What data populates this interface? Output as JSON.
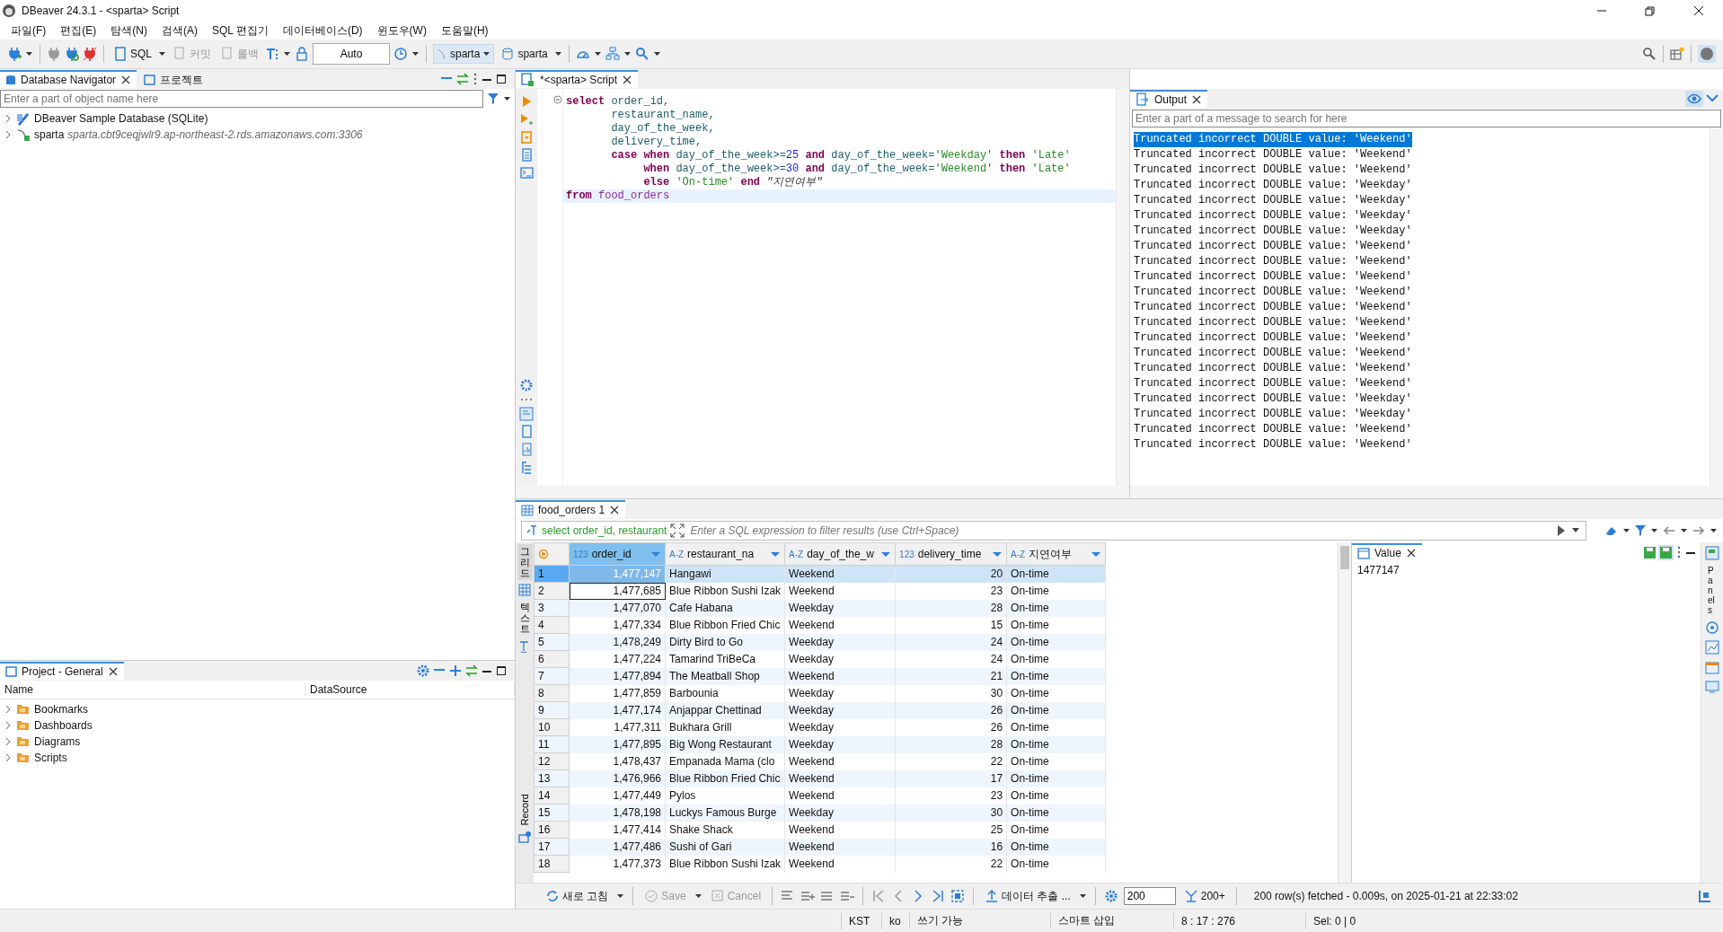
{
  "window": {
    "title": "DBeaver 24.3.1 - <sparta> Script"
  },
  "menu": [
    "파일(F)",
    "편집(E)",
    "탐색(N)",
    "검색(A)",
    "SQL 편집기",
    "데이터베이스(D)",
    "윈도우(W)",
    "도움말(H)"
  ],
  "toolbar": {
    "sql": {
      "label": "SQL"
    },
    "commit": {
      "label": "커밋",
      "disabled": true
    },
    "rollback": {
      "label": "롤백",
      "disabled": true
    },
    "transaction_mode": {
      "value": "Auto"
    },
    "datasource": {
      "label": "sparta"
    },
    "schema": {
      "label": "sparta"
    }
  },
  "navigator": {
    "tabs": [
      {
        "label": "Database Navigator",
        "selected": true
      },
      {
        "label": "프로젝트",
        "selected": false
      }
    ],
    "search": {
      "placeholder": "Enter a part of object name here"
    },
    "tree": [
      {
        "name": "DBeaver Sample Database (SQLite)",
        "kind": "sqlite"
      },
      {
        "name": "sparta",
        "detail": "sparta.cbt9ceqjwlr9.ap-northeast-2.rds.amazonaws.com:3306",
        "kind": "mysql"
      }
    ]
  },
  "project": {
    "title": "Project - General",
    "columns": [
      "Name",
      "DataSource"
    ],
    "items": [
      "Bookmarks",
      "Dashboards",
      "Diagrams",
      "Scripts"
    ]
  },
  "editor": {
    "tab": "*<sparta> Script",
    "lines": [
      [
        {
          "t": "select",
          "kind": "keyword"
        },
        {
          "t": " order_id,",
          "kind": "identifier"
        }
      ],
      [
        {
          "t": "       restaurant_name,",
          "kind": "identifier"
        }
      ],
      [
        {
          "t": "       day_of_the_week,",
          "kind": "identifier"
        }
      ],
      [
        {
          "t": "       delivery_time,",
          "kind": "identifier"
        }
      ],
      [
        {
          "t": "       case when",
          "kind": "keyword"
        },
        {
          "t": " day_of_the_week>=",
          "kind": "identifier"
        },
        {
          "t": "25",
          "kind": "number"
        },
        {
          "t": " and",
          "kind": "keyword"
        },
        {
          "t": " day_of_the_week=",
          "kind": "identifier"
        },
        {
          "t": "'Weekday'",
          "kind": "string"
        },
        {
          "t": " then",
          "kind": "keyword"
        },
        {
          "t": " 'Late'",
          "kind": "string"
        }
      ],
      [
        {
          "t": "            when",
          "kind": "keyword"
        },
        {
          "t": " day_of_the_week>=",
          "kind": "identifier"
        },
        {
          "t": "30",
          "kind": "number"
        },
        {
          "t": " and",
          "kind": "keyword"
        },
        {
          "t": " day_of_the_week=",
          "kind": "identifier"
        },
        {
          "t": "'Weekend'",
          "kind": "string"
        },
        {
          "t": " then",
          "kind": "keyword"
        },
        {
          "t": " 'Late'",
          "kind": "string"
        }
      ],
      [
        {
          "t": "            else",
          "kind": "keyword"
        },
        {
          "t": " 'On-time'",
          "kind": "string"
        },
        {
          "t": " end",
          "kind": "keyword"
        },
        {
          "t": " \"지연여부\"",
          "kind": "alias"
        }
      ],
      [
        {
          "t": "from",
          "kind": "keyword"
        },
        {
          "t": " food_orders",
          "kind": "table"
        }
      ]
    ]
  },
  "output": {
    "tab": "Output",
    "search": {
      "placeholder": "Enter a part of a message to search for here"
    },
    "lines": [
      {
        "text": "Truncated incorrect DOUBLE value: 'Weekend'",
        "selected": true
      },
      {
        "text": "Truncated incorrect DOUBLE value: 'Weekend'",
        "selected": false
      },
      {
        "text": "Truncated incorrect DOUBLE value: 'Weekend'",
        "selected": false
      },
      {
        "text": "Truncated incorrect DOUBLE value: 'Weekday'",
        "selected": false
      },
      {
        "text": "Truncated incorrect DOUBLE value: 'Weekday'",
        "selected": false
      },
      {
        "text": "Truncated incorrect DOUBLE value: 'Weekday'",
        "selected": false
      },
      {
        "text": "Truncated incorrect DOUBLE value: 'Weekday'",
        "selected": false
      },
      {
        "text": "Truncated incorrect DOUBLE value: 'Weekend'",
        "selected": false
      },
      {
        "text": "Truncated incorrect DOUBLE value: 'Weekend'",
        "selected": false
      },
      {
        "text": "Truncated incorrect DOUBLE value: 'Weekend'",
        "selected": false
      },
      {
        "text": "Truncated incorrect DOUBLE value: 'Weekend'",
        "selected": false
      },
      {
        "text": "Truncated incorrect DOUBLE value: 'Weekend'",
        "selected": false
      },
      {
        "text": "Truncated incorrect DOUBLE value: 'Weekend'",
        "selected": false
      },
      {
        "text": "Truncated incorrect DOUBLE value: 'Weekend'",
        "selected": false
      },
      {
        "text": "Truncated incorrect DOUBLE value: 'Weekend'",
        "selected": false
      },
      {
        "text": "Truncated incorrect DOUBLE value: 'Weekend'",
        "selected": false
      },
      {
        "text": "Truncated incorrect DOUBLE value: 'Weekend'",
        "selected": false
      },
      {
        "text": "Truncated incorrect DOUBLE value: 'Weekday'",
        "selected": false
      },
      {
        "text": "Truncated incorrect DOUBLE value: 'Weekday'",
        "selected": false
      },
      {
        "text": "Truncated incorrect DOUBLE value: 'Weekend'",
        "selected": false
      },
      {
        "text": "Truncated incorrect DOUBLE value: 'Weekend'",
        "selected": false
      }
    ]
  },
  "results": {
    "tab": "food_orders 1",
    "query": "select order_id, restaurant",
    "filter": {
      "placeholder": "Enter a SQL expression to filter results (use Ctrl+Space)"
    },
    "views": [
      {
        "label": "그리드",
        "selected": true
      },
      {
        "label": "텍스트",
        "selected": false
      }
    ],
    "record": "Record",
    "columns": [
      {
        "type": "123",
        "name": "order_id",
        "selected": true,
        "kind": "number"
      },
      {
        "type": "A-Z",
        "name": "restaurant_na",
        "selected": false,
        "kind": "text"
      },
      {
        "type": "A-Z",
        "name": "day_of_the_w",
        "selected": false,
        "kind": "text"
      },
      {
        "type": "123",
        "name": "delivery_time",
        "selected": false,
        "kind": "number"
      },
      {
        "type": "A-Z",
        "name": "지연여부",
        "selected": false,
        "kind": "text"
      }
    ],
    "rows": [
      {
        "num": "1",
        "cells": [
          "1,477,147",
          "Hangawi",
          "Weekend",
          "20",
          "On-time"
        ],
        "selected": true,
        "focused": false
      },
      {
        "num": "2",
        "cells": [
          "1,477,685",
          "Blue Ribbon Sushi Izak",
          "Weekend",
          "23",
          "On-time"
        ],
        "selected": false,
        "focused": true
      },
      {
        "num": "3",
        "cells": [
          "1,477,070",
          "Cafe Habana",
          "Weekday",
          "28",
          "On-time"
        ],
        "selected": false,
        "focused": false
      },
      {
        "num": "4",
        "cells": [
          "1,477,334",
          "Blue Ribbon Fried Chic",
          "Weekend",
          "15",
          "On-time"
        ],
        "selected": false,
        "focused": false
      },
      {
        "num": "5",
        "cells": [
          "1,478,249",
          "Dirty Bird to Go",
          "Weekday",
          "24",
          "On-time"
        ],
        "selected": false,
        "focused": false
      },
      {
        "num": "6",
        "cells": [
          "1,477,224",
          "Tamarind TriBeCa",
          "Weekday",
          "24",
          "On-time"
        ],
        "selected": false,
        "focused": false
      },
      {
        "num": "7",
        "cells": [
          "1,477,894",
          "The Meatball Shop",
          "Weekend",
          "21",
          "On-time"
        ],
        "selected": false,
        "focused": false
      },
      {
        "num": "8",
        "cells": [
          "1,477,859",
          "Barbounia",
          "Weekday",
          "30",
          "On-time"
        ],
        "selected": false,
        "focused": false
      },
      {
        "num": "9",
        "cells": [
          "1,477,174",
          "Anjappar Chettinad",
          "Weekday",
          "26",
          "On-time"
        ],
        "selected": false,
        "focused": false
      },
      {
        "num": "10",
        "cells": [
          "1,477,311",
          "Bukhara Grill",
          "Weekday",
          "26",
          "On-time"
        ],
        "selected": false,
        "focused": false
      },
      {
        "num": "11",
        "cells": [
          "1,477,895",
          "Big Wong Restaurant",
          "Weekday",
          "28",
          "On-time"
        ],
        "selected": false,
        "focused": false
      },
      {
        "num": "12",
        "cells": [
          "1,478,437",
          "Empanada Mama (clo",
          "Weekend",
          "22",
          "On-time"
        ],
        "selected": false,
        "focused": false
      },
      {
        "num": "13",
        "cells": [
          "1,476,966",
          "Blue Ribbon Fried Chic",
          "Weekend",
          "17",
          "On-time"
        ],
        "selected": false,
        "focused": false
      },
      {
        "num": "14",
        "cells": [
          "1,477,449",
          "Pylos",
          "Weekend",
          "23",
          "On-time"
        ],
        "selected": false,
        "focused": false
      },
      {
        "num": "15",
        "cells": [
          "1,478,198",
          "Luckys Famous Burge",
          "Weekday",
          "30",
          "On-time"
        ],
        "selected": false,
        "focused": false
      },
      {
        "num": "16",
        "cells": [
          "1,477,414",
          "Shake Shack",
          "Weekend",
          "25",
          "On-time"
        ],
        "selected": false,
        "focused": false
      },
      {
        "num": "17",
        "cells": [
          "1,477,486",
          "Sushi of Gari",
          "Weekend",
          "16",
          "On-time"
        ],
        "selected": false,
        "focused": false
      },
      {
        "num": "18",
        "cells": [
          "1,477,373",
          "Blue Ribbon Sushi Izak",
          "Weekend",
          "22",
          "On-time"
        ],
        "selected": false,
        "focused": false
      }
    ],
    "value_panel": {
      "tab": "Value",
      "value": "1477147"
    },
    "panels_label": "Panels",
    "bottom": {
      "refresh": "새로 고침",
      "save": {
        "label": "Save",
        "disabled": true
      },
      "cancel": {
        "label": "Cancel",
        "disabled": true
      },
      "export": "데이터 추출 ...",
      "fetch_size": "200",
      "fetch_more": "200+",
      "message": "200 row(s) fetched - 0.009s, on 2025-01-21 at 22:33:02"
    }
  },
  "status_bar": [
    "KST",
    "ko",
    "쓰기 가능",
    "스마트 삽입",
    "8 : 17 : 276",
    "Sel: 0 | 0"
  ]
}
